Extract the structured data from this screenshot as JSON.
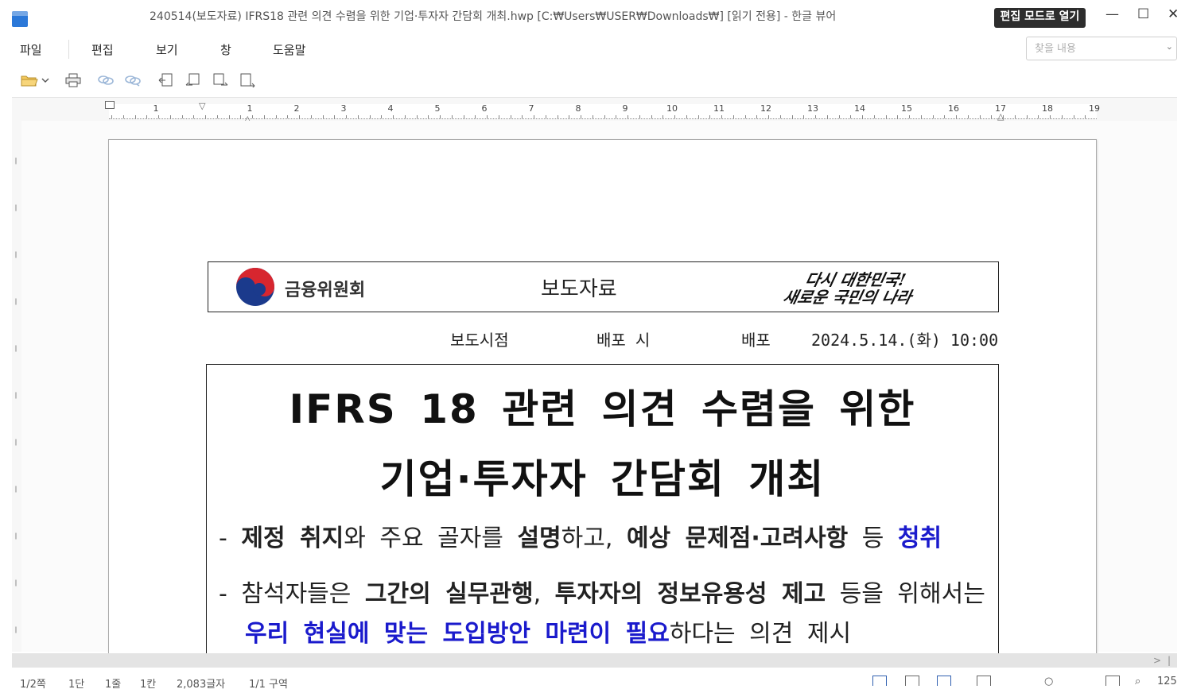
{
  "window": {
    "title": "240514(보도자료) IFRS18 관련 의견 수렴을 위한 기업·투자자 간담회 개최.hwp [C:₩Users₩USER₩Downloads₩] [읽기 전용] - 한글 뷰어",
    "edit_mode_button": "편집 모드로 열기",
    "minimize": "—",
    "maximize": "☐",
    "close": "✕"
  },
  "menu": {
    "file": "파일",
    "edit": "편집",
    "view": "보기",
    "window": "창",
    "help": "도움말"
  },
  "search": {
    "placeholder": "찾을 내용"
  },
  "toolbar_icons": [
    "open-folder-icon",
    "dropdown-icon",
    "print-icon",
    "link-icon",
    "link-alt-icon",
    "page-first-icon",
    "page-prev-icon",
    "page-next-icon",
    "page-last-icon"
  ],
  "ruler": {
    "numbers": [
      "1",
      "1",
      "2",
      "3",
      "4",
      "5",
      "6",
      "7",
      "8",
      "9",
      "10",
      "11",
      "12",
      "13",
      "14",
      "15",
      "16",
      "17",
      "18",
      "19"
    ]
  },
  "document": {
    "org_name": "금융위원회",
    "press_label": "보도자료",
    "slogan_line1": "다시 대한민국!",
    "slogan_line2": "새로운 국민의 나라",
    "release_label": "보도시점",
    "release_distribute1": "배포 시",
    "release_distribute2": "배포",
    "release_datetime": "2024.5.14.(화) 10:00",
    "headline_line1": "IFRS 18 관련 의견 수렴을 위한",
    "headline_line2": "기업·투자자 간담회 개최",
    "bullet1": {
      "dash": "-",
      "b1": "제정 취지",
      "t1": "와 주요 골자를 ",
      "b2": "설명",
      "t2": "하고, ",
      "b3": "예상 문제점·고려사항",
      "t3": " 등 ",
      "blue1": "청취"
    },
    "bullet2": {
      "dash": "-",
      "t1": "참석자들은 ",
      "b1": "그간의 실무관행",
      "t2": ", ",
      "b2": "투자자의 정보유용성 제고",
      "t3": " 등을 위해서는",
      "blue1": "우리 현실에 맞는 도입방안 마련이 필요",
      "t4": "하다는 의견 제시"
    }
  },
  "status": {
    "page": "1/2쪽",
    "section": "1단",
    "line": "1줄",
    "col": "1칸",
    "chars": "2,083글자",
    "area": "1/1 구역",
    "zoom": "125"
  }
}
